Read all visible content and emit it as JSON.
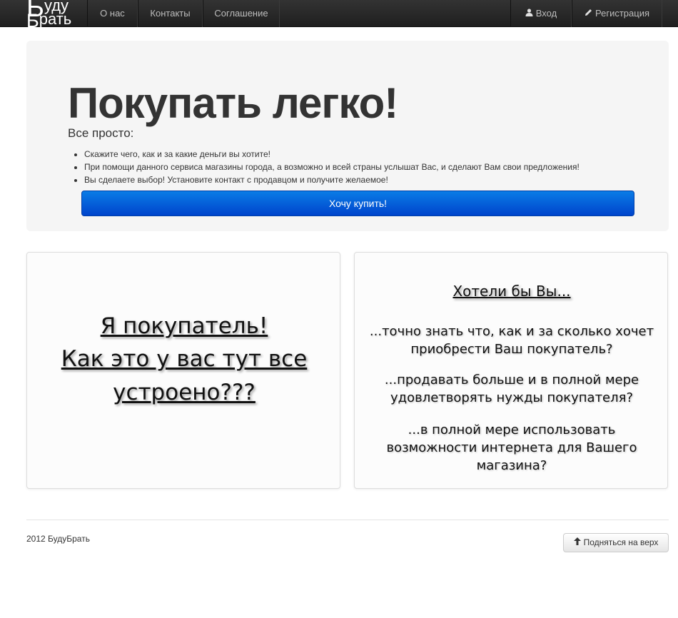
{
  "navbar": {
    "brand_line1": "Буду",
    "brand_line2": "Брать",
    "items": [
      {
        "label": "О нас"
      },
      {
        "label": "Контакты"
      },
      {
        "label": "Соглашение"
      }
    ],
    "login_label": "Вход",
    "register_label": "Регистрация",
    "login_icon": "user-icon",
    "register_icon": "pencil-icon"
  },
  "hero": {
    "title": "Покупать легко!",
    "subtitle": "Все просто:",
    "bullets": [
      "Скажите чего, как и за какие деньги вы хотите!",
      "При помощи данного сервиса магазины города, а возможно и всей страны услышат Вас, и сделают Вам свои предложения!",
      "Вы сделаете выбор! Установите контакт с продавцом и получите желаемое!"
    ],
    "button_label": "Хочу купить!"
  },
  "card_buyer": {
    "lines": [
      "Я покупатель!",
      "Как это у вас тут все",
      "устроено???"
    ]
  },
  "card_seller": {
    "heading": "Хотели бы Вы...",
    "paragraphs": [
      [
        "...точно знать что, как и за сколько хочет",
        "приобрести Ваш покупатель?"
      ],
      [
        "...продавать больше и в полной мере",
        "удовлетворять нужды покупателя?"
      ],
      [
        "...в полной мере использовать",
        "возможности интернета для Вашего",
        "магазина?"
      ]
    ]
  },
  "footer": {
    "copyright": "2012 БудуБрать",
    "top_button_label": "Подняться на верх",
    "top_button_icon": "arrow-up-icon"
  },
  "colors": {
    "navbar": "#222222",
    "primary_button": "#0064d8",
    "hero_bg": "#f5f5f5"
  }
}
